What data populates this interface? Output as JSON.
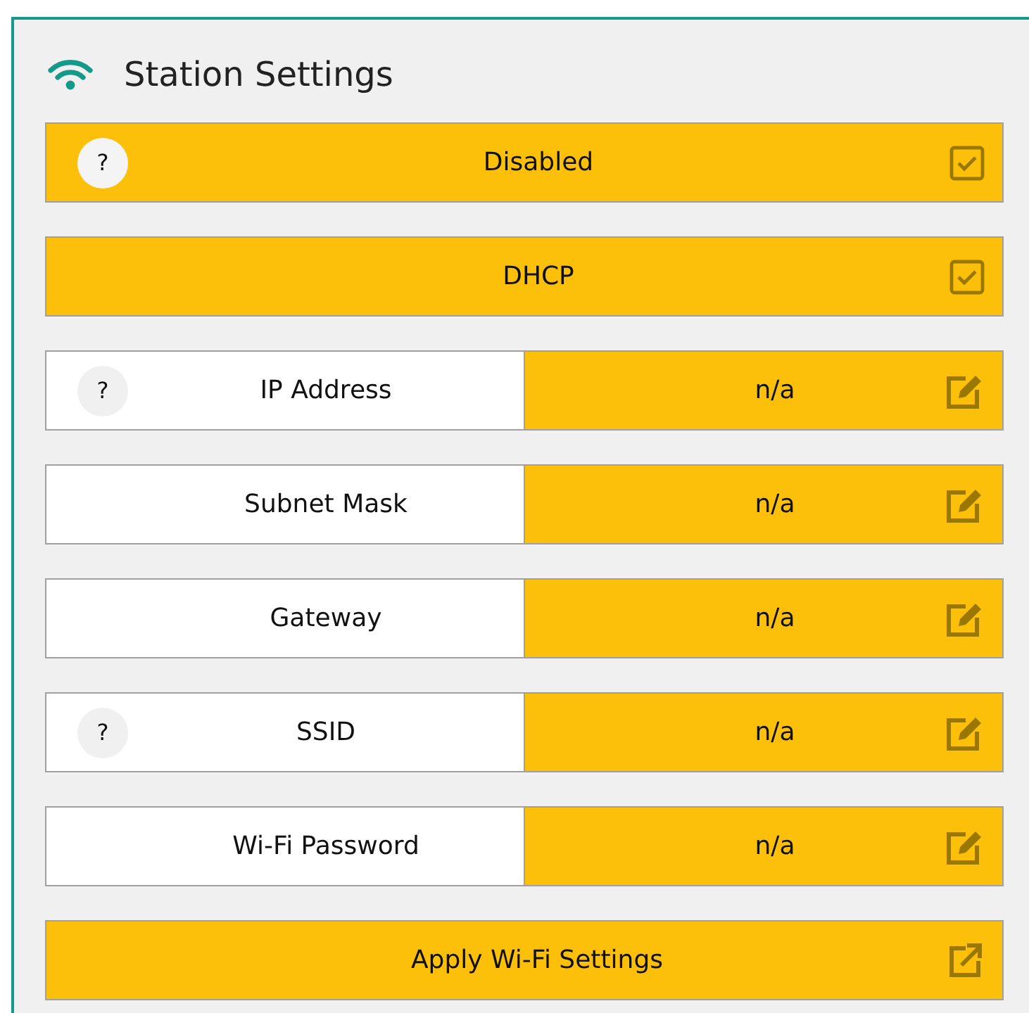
{
  "title": "Station Settings",
  "toggles": [
    {
      "label": "Disabled",
      "checked": true,
      "help": "?"
    },
    {
      "label": "DHCP",
      "checked": true
    }
  ],
  "fields": [
    {
      "label": "IP Address",
      "value": "n/a",
      "help": "?"
    },
    {
      "label": "Subnet Mask",
      "value": "n/a"
    },
    {
      "label": "Gateway",
      "value": "n/a"
    },
    {
      "label": "SSID",
      "value": "n/a",
      "help": "?"
    },
    {
      "label": "Wi-Fi Password",
      "value": "n/a"
    }
  ],
  "apply_button": {
    "label": "Apply Wi-Fi Settings"
  }
}
